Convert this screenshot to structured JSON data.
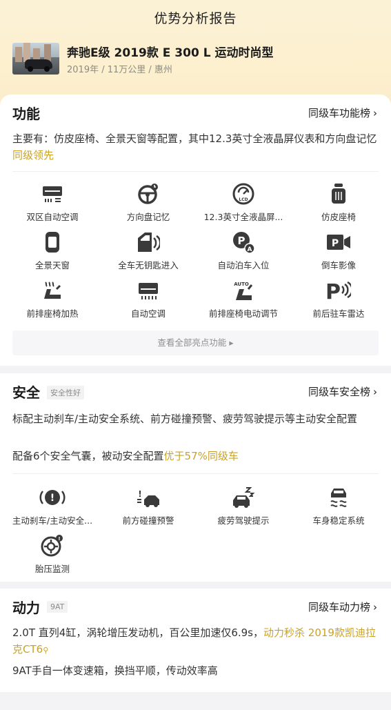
{
  "header": {
    "title": "优势分析报告",
    "car_name": "奔驰E级 2019款 E 300 L 运动时尚型",
    "car_meta": "2019年 / 11万公里 / 惠州"
  },
  "function": {
    "title": "功能",
    "link": "同级车功能榜",
    "summary_main": "主要有：仿皮座椅、全景天窗等配置，其中12.3英寸全液晶屏仪表和方向盘记忆",
    "summary_highlight": "同级领先",
    "items": [
      {
        "label": "双区自动空调",
        "icon": "dual-zone-ac-icon"
      },
      {
        "label": "方向盘记忆",
        "icon": "steering-wheel-icon"
      },
      {
        "label": "12.3英寸全液晶屏...",
        "icon": "lcd-gauge-icon"
      },
      {
        "label": "仿皮座椅",
        "icon": "leather-seat-icon"
      },
      {
        "label": "全景天窗",
        "icon": "panoramic-sunroof-icon"
      },
      {
        "label": "全车无钥匙进入",
        "icon": "keyless-entry-icon"
      },
      {
        "label": "自动泊车入位",
        "icon": "auto-parking-icon"
      },
      {
        "label": "倒车影像",
        "icon": "reverse-camera-icon"
      },
      {
        "label": "前排座椅加热",
        "icon": "seat-heating-icon"
      },
      {
        "label": "自动空调",
        "icon": "auto-ac-icon"
      },
      {
        "label": "前排座椅电动调节",
        "icon": "power-seat-icon"
      },
      {
        "label": "前后驻车雷达",
        "icon": "parking-radar-icon"
      }
    ],
    "more": "查看全部亮点功能 ▸"
  },
  "safety": {
    "title": "安全",
    "tag": "安全性好",
    "link": "同级车安全榜",
    "line1": "标配主动刹车/主动安全系统、前方碰撞预警、疲劳驾驶提示等主动安全配置",
    "line2_main": "配备6个安全气囊，被动安全配置",
    "line2_highlight": "优于57%同级车",
    "items": [
      {
        "label": "主动刹车/主动安全...",
        "icon": "active-brake-icon"
      },
      {
        "label": "前方碰撞预警",
        "icon": "collision-warning-icon"
      },
      {
        "label": "疲劳驾驶提示",
        "icon": "fatigue-alert-icon"
      },
      {
        "label": "车身稳定系统",
        "icon": "stability-control-icon"
      },
      {
        "label": "胎压监测",
        "icon": "tire-pressure-icon"
      }
    ]
  },
  "power": {
    "title": "动力",
    "tag": "9AT",
    "link": "同级车动力榜",
    "line1_main": "2.0T 直列4缸，涡轮增压发动机，百公里加速仅6.9s，",
    "line1_highlight": "动力秒杀 2019款凯迪拉克CT6",
    "line2": "9AT手自一体变速箱，换挡平顺，传动效率高"
  },
  "colors": {
    "accent": "#c9a227",
    "hero_bg": "#fcf0cf",
    "icon": "#3a3a3a"
  }
}
